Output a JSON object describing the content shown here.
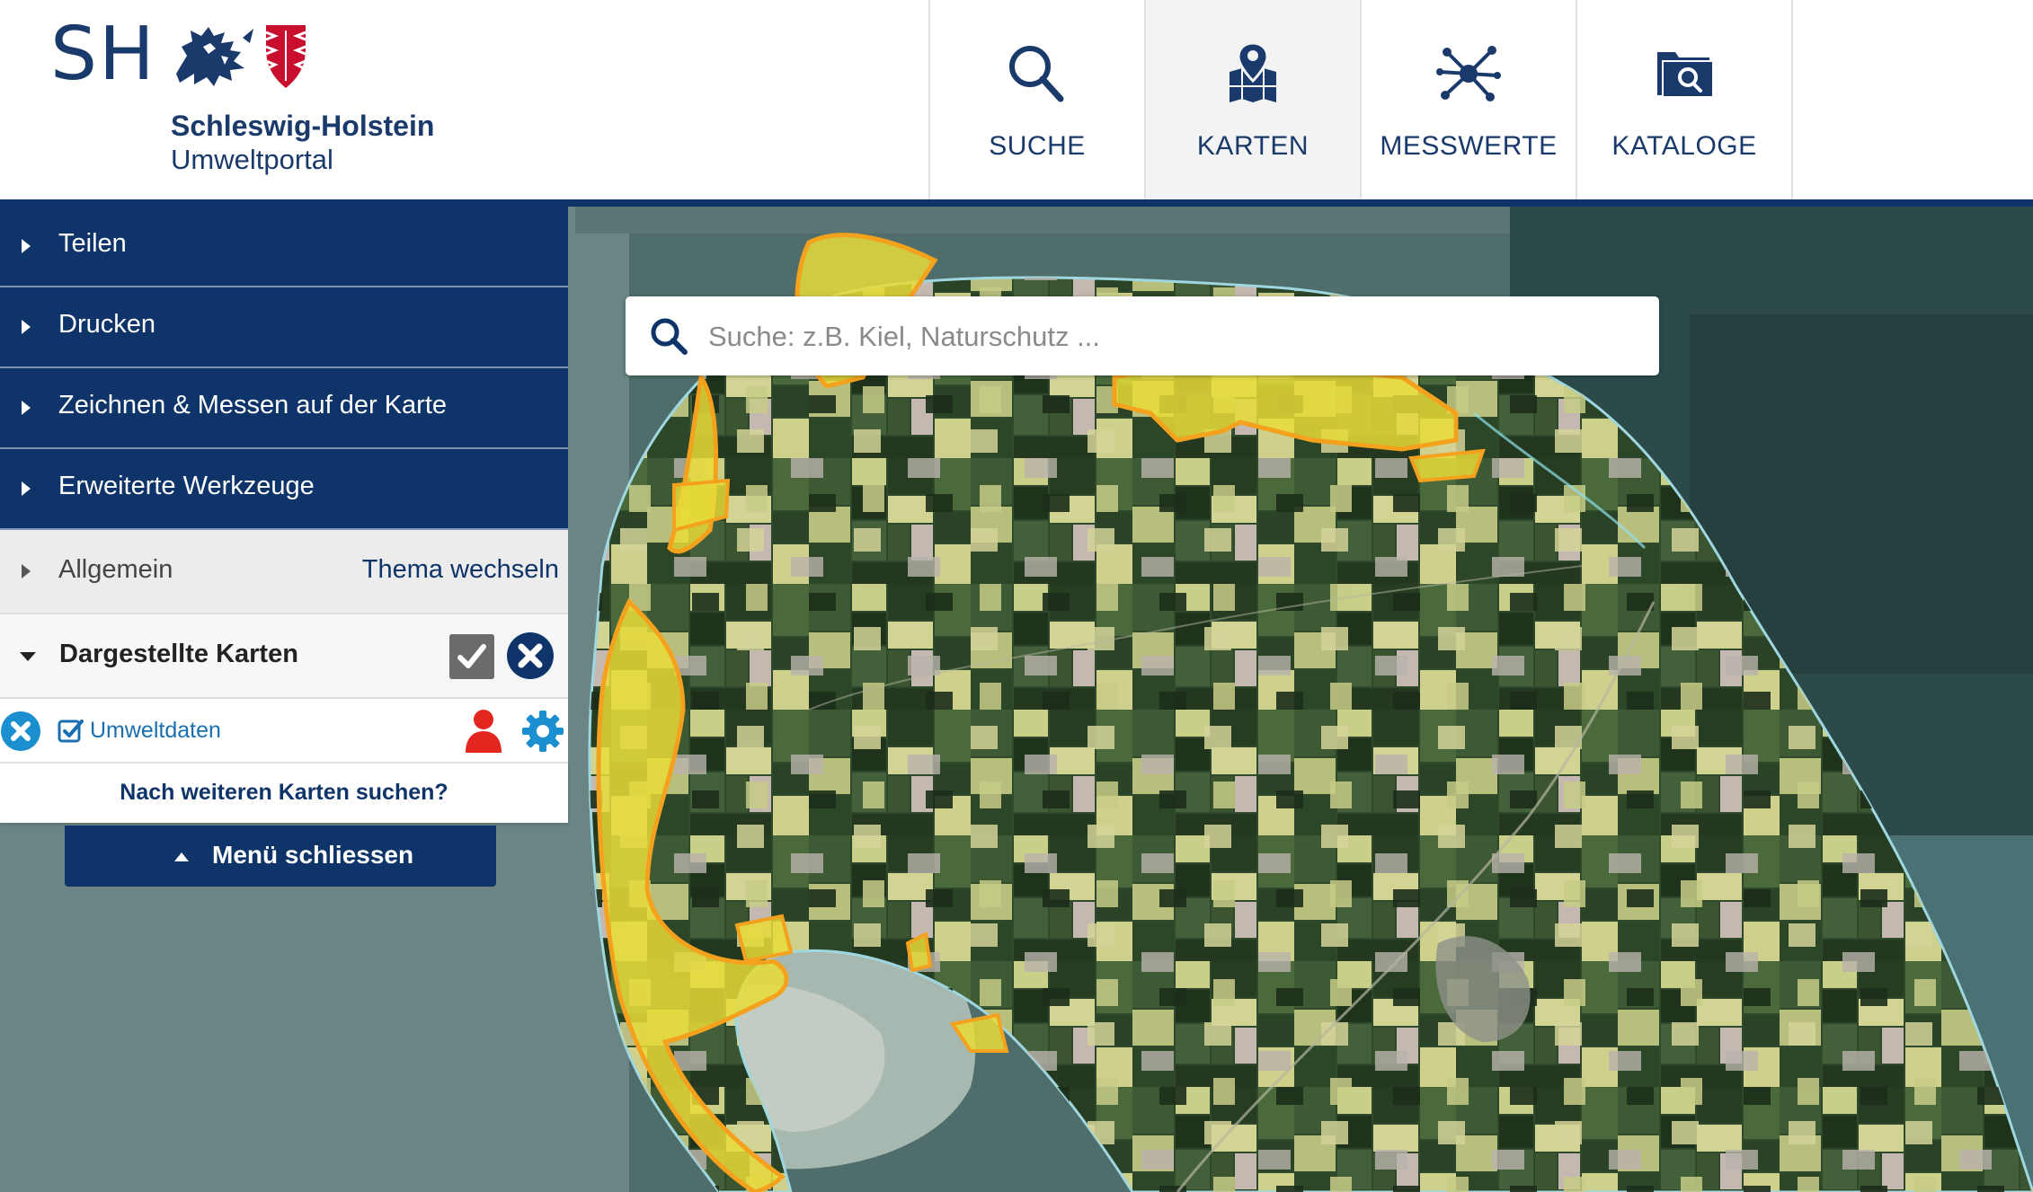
{
  "header": {
    "logo_abbr": "SH",
    "logo_name": "Schleswig-Holstein",
    "logo_sub": "Umweltportal",
    "nav": [
      {
        "label": "SUCHE",
        "icon": "search-icon"
      },
      {
        "label": "KARTEN",
        "icon": "map-icon"
      },
      {
        "label": "MESSWERTE",
        "icon": "network-icon"
      },
      {
        "label": "KATALOGE",
        "icon": "catalog-icon"
      }
    ],
    "active_nav": "KARTEN"
  },
  "search": {
    "placeholder": "Suche: z.B. Kiel, Naturschutz ...",
    "value": ""
  },
  "menu": {
    "items": [
      {
        "label": "Teilen"
      },
      {
        "label": "Drucken"
      },
      {
        "label": "Zeichnen & Messen auf der Karte"
      },
      {
        "label": "Erweiterte Werkzeuge"
      }
    ],
    "general": {
      "label": "Allgemein",
      "theme_link": "Thema wechseln"
    },
    "maps": {
      "label": "Dargestellte Karten",
      "layers": [
        {
          "name": "Umweltdaten",
          "checked": true
        }
      ],
      "more": "Nach weiteren Karten suchen?"
    },
    "close_label": "Menü schliessen"
  },
  "colors": {
    "brand_navy": "#0e3469",
    "brand_red": "#c8102e",
    "highlight_yellow": "#f2e640",
    "highlight_outline": "#f4a21e",
    "link_blue": "#1a6fb0"
  }
}
